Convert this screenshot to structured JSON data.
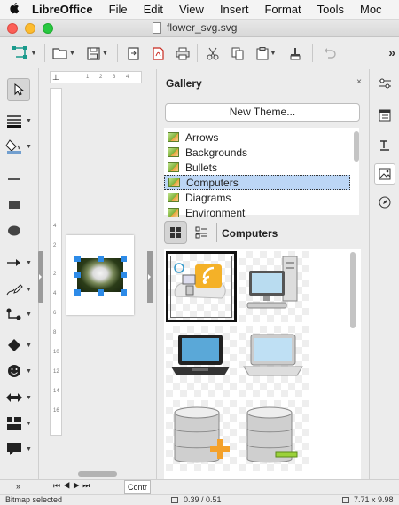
{
  "menubar": {
    "apple_icon": "apple-logo",
    "items": [
      "LibreOffice",
      "File",
      "Edit",
      "View",
      "Insert",
      "Format",
      "Tools",
      "Moc"
    ]
  },
  "window": {
    "title": "flower_svg.svg"
  },
  "gallery": {
    "title": "Gallery",
    "close_label": "×",
    "new_theme_label": "New Theme...",
    "themes": [
      {
        "label": "Arrows",
        "selected": false
      },
      {
        "label": "Backgrounds",
        "selected": false
      },
      {
        "label": "Bullets",
        "selected": false
      },
      {
        "label": "Computers",
        "selected": true
      },
      {
        "label": "Diagrams",
        "selected": false
      },
      {
        "label": "Environment",
        "selected": false
      }
    ],
    "current_theme": "Computers",
    "items": [
      {
        "icon": "computer-network-icon",
        "selected": true
      },
      {
        "icon": "desktop-computer-icon",
        "selected": false
      },
      {
        "icon": "laptop-dark-icon",
        "selected": false
      },
      {
        "icon": "laptop-silver-icon",
        "selected": false
      },
      {
        "icon": "database-add-icon",
        "selected": false
      },
      {
        "icon": "database-drive-icon",
        "selected": false
      }
    ]
  },
  "navbar": {
    "sheet_tab": "Contr",
    "overflow_label": "»"
  },
  "toolbar": {
    "more_label": "»"
  },
  "statusbar": {
    "status": "Bitmap selected",
    "position": "0.39 / 0.51",
    "size": "7.71 x 9.98"
  },
  "ruler": {
    "h_ticks": [
      "1",
      "2",
      "3",
      "4"
    ],
    "v_ticks": [
      "4",
      "2",
      "2",
      "4",
      "6",
      "8",
      "10",
      "12",
      "14",
      "16"
    ]
  },
  "colors": {
    "accent": "#2d8be8",
    "selection": "#bcd6f5",
    "handle": "#2d8be8"
  }
}
